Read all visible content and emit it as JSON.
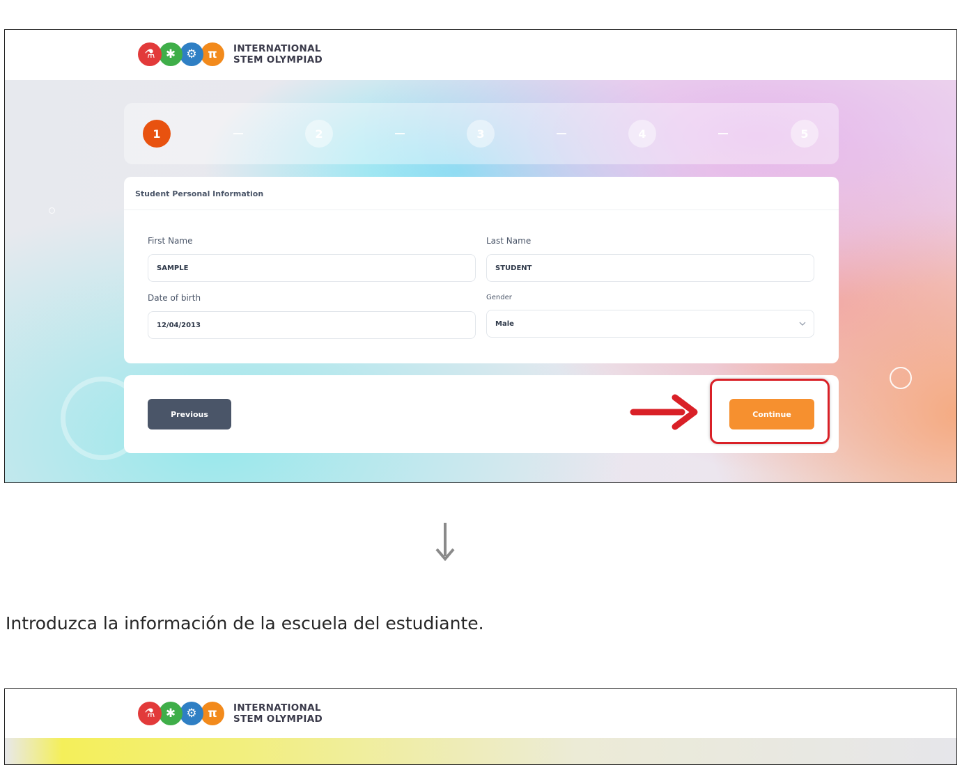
{
  "brand": {
    "name_line1": "INTERNATIONAL",
    "name_line2": "STEM OLYMPIAD",
    "logo_icons": [
      {
        "icon": "flask-icon",
        "color": "#e23a3a",
        "symbol": "⚗"
      },
      {
        "icon": "bug-icon",
        "color": "#3fae49",
        "symbol": "✱"
      },
      {
        "icon": "gear-icon",
        "color": "#2f7fc4",
        "symbol": "⚙"
      },
      {
        "icon": "pi-icon",
        "color": "#f28a1c",
        "symbol": "π"
      }
    ]
  },
  "stepper": {
    "current": 1,
    "steps": [
      "1",
      "2",
      "3",
      "4",
      "5"
    ]
  },
  "form": {
    "title": "Student Personal Information",
    "first_name_label": "First Name",
    "first_name_value": "SAMPLE",
    "last_name_label": "Last Name",
    "last_name_value": "STUDENT",
    "dob_label": "Date of birth",
    "dob_value": "12/04/2013",
    "gender_label": "Gender",
    "gender_value": "Male"
  },
  "nav": {
    "previous_label": "Previous",
    "continue_label": "Continue"
  },
  "annotation": {
    "highlight_color": "#d92027",
    "arrow_color": "#d92027"
  },
  "caption": "Introduzca la información de la escuela del estudiante.",
  "second_screenshot": {
    "brand_line1": "INTERNATIONAL",
    "brand_line2": "STEM OLYMPIAD"
  }
}
